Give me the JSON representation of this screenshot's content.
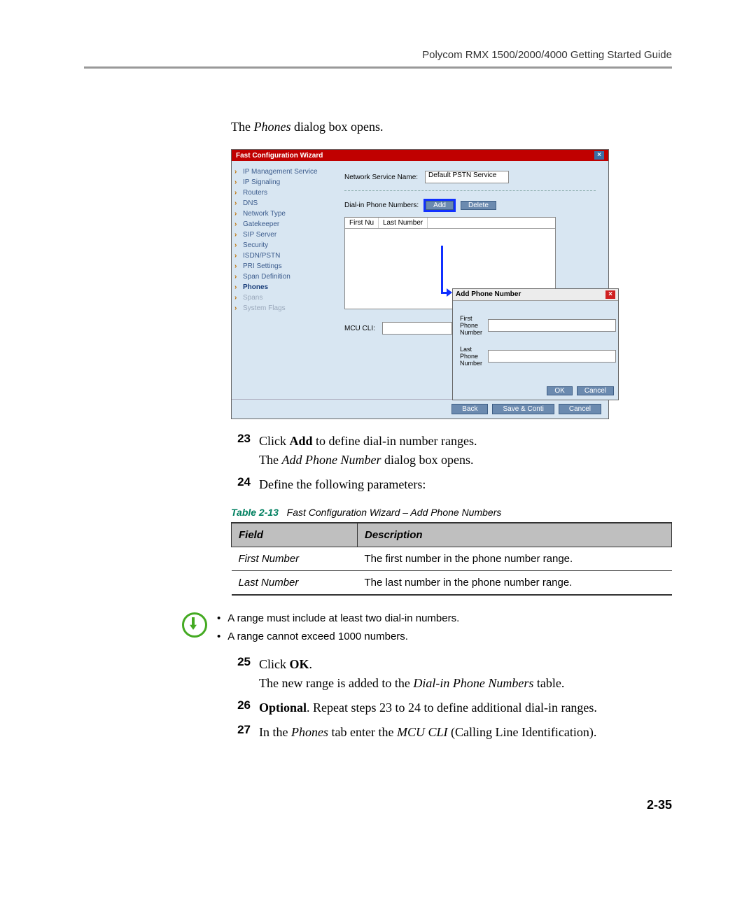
{
  "header": {
    "guide": "Polycom RMX 1500/2000/4000 Getting Started Guide"
  },
  "intro": {
    "prefix": "The ",
    "italic": "Phones",
    "suffix": " dialog box opens."
  },
  "wizard": {
    "title": "Fast Configuration Wizard",
    "nav": {
      "items": [
        "IP Management Service",
        "IP Signaling",
        "Routers",
        "DNS",
        "Network Type",
        "Gatekeeper",
        "SIP Server",
        "Security",
        "ISDN/PSTN",
        "PRI Settings",
        "Span Definition",
        "Phones",
        "Spans",
        "System Flags"
      ],
      "active_index": 11,
      "dim_index": 12
    },
    "svc_label": "Network Service Name:",
    "svc_value": "Default PSTN Service",
    "dialin_label": "Dial-in Phone Numbers:",
    "add_btn": "Add",
    "delete_btn": "Delete",
    "col_first": "First Nu",
    "col_last": "Last Number",
    "mcu_label": "MCU CLI:",
    "footer": {
      "back": "Back",
      "save": "Save & Conti",
      "cancel": "Cancel"
    }
  },
  "sub_dialog": {
    "title": "Add Phone Number",
    "first_label": "First Phone Number",
    "last_label": "Last Phone Number",
    "ok": "OK",
    "cancel": "Cancel"
  },
  "steps": {
    "s23": {
      "num": "23",
      "a": "Click ",
      "b": "Add",
      "c": " to define dial-in number ranges.",
      "d1": "The ",
      "d2": "Add Phone Number",
      "d3": " dialog box opens."
    },
    "s24": {
      "num": "24",
      "text": "Define the following parameters:"
    },
    "s25": {
      "num": "25",
      "a": "Click ",
      "b": "OK",
      "c": ".",
      "d1": "The new range is added to the ",
      "d2": "Dial-in Phone Numbers",
      "d3": " table."
    },
    "s26": {
      "num": "26",
      "a": "Optional",
      "b": ". Repeat steps 23 to 24 to define additional dial-in ranges."
    },
    "s27": {
      "num": "27",
      "a": "In the ",
      "b": "Phones",
      "c": " tab enter the ",
      "d": "MCU CLI",
      "e": " (Calling Line Identification)."
    }
  },
  "table": {
    "caption_label": "Table 2-13",
    "caption_text": "Fast Configuration Wizard – Add Phone Numbers",
    "h1": "Field",
    "h2": "Description",
    "rows": [
      {
        "field": "First Number",
        "desc": "The first number in the phone number range."
      },
      {
        "field": "Last Number",
        "desc": "The last number in the phone number range."
      }
    ]
  },
  "note": {
    "line1": "A range must include at least two dial-in numbers.",
    "line2": "A range cannot exceed 1000 numbers."
  },
  "page_number": "2-35"
}
